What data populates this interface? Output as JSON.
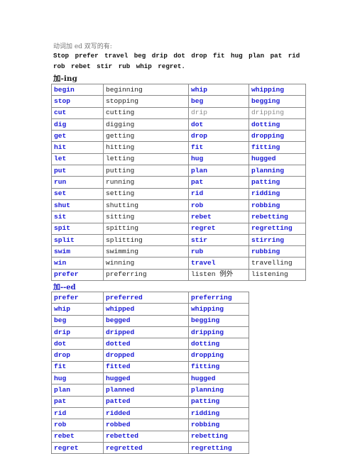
{
  "intro": "动词加 ed 双写的有:",
  "word_list": "Stop  prefer  travel   beg  drip  dot  drop  fit  hug plan  pat   rid   rob  rebet   stir   rub   whip   regret.",
  "ing_section": {
    "title": "加-ing",
    "rows": [
      [
        {
          "t": "begin",
          "c": "b"
        },
        {
          "t": "beginning",
          "c": "k"
        },
        {
          "t": "whip",
          "c": "b"
        },
        {
          "t": "whipping",
          "c": "b"
        }
      ],
      [
        {
          "t": "stop",
          "c": "b"
        },
        {
          "t": "stopping",
          "c": "k"
        },
        {
          "t": "beg",
          "c": "b"
        },
        {
          "t": "begging",
          "c": "b"
        }
      ],
      [
        {
          "t": "cut",
          "c": "b"
        },
        {
          "t": "cutting",
          "c": "k"
        },
        {
          "t": "drip",
          "c": "g"
        },
        {
          "t": "dripping",
          "c": "g"
        }
      ],
      [
        {
          "t": "dig",
          "c": "b"
        },
        {
          "t": "digging",
          "c": "k"
        },
        {
          "t": "dot",
          "c": "b"
        },
        {
          "t": "dotting",
          "c": "b"
        }
      ],
      [
        {
          "t": "get",
          "c": "b"
        },
        {
          "t": "getting",
          "c": "k"
        },
        {
          "t": "drop",
          "c": "b"
        },
        {
          "t": "dropping",
          "c": "b"
        }
      ],
      [
        {
          "t": "hit",
          "c": "b"
        },
        {
          "t": "hitting",
          "c": "k"
        },
        {
          "t": "fit",
          "c": "b"
        },
        {
          "t": "fitting",
          "c": "b"
        }
      ],
      [
        {
          "t": "let",
          "c": "b"
        },
        {
          "t": "letting",
          "c": "k"
        },
        {
          "t": "hug",
          "c": "b"
        },
        {
          "t": "hugged",
          "c": "b"
        }
      ],
      [
        {
          "t": "put",
          "c": "b"
        },
        {
          "t": "putting",
          "c": "k"
        },
        {
          "t": "plan",
          "c": "b"
        },
        {
          "t": "planning",
          "c": "b"
        }
      ],
      [
        {
          "t": "run",
          "c": "b"
        },
        {
          "t": "running",
          "c": "k"
        },
        {
          "t": "pat",
          "c": "b"
        },
        {
          "t": "patting",
          "c": "b"
        }
      ],
      [
        {
          "t": "set",
          "c": "b"
        },
        {
          "t": "setting",
          "c": "k"
        },
        {
          "t": "rid",
          "c": "b"
        },
        {
          "t": "ridding",
          "c": "b"
        }
      ],
      [
        {
          "t": "shut",
          "c": "b"
        },
        {
          "t": "shutting",
          "c": "k"
        },
        {
          "t": "rob",
          "c": "b"
        },
        {
          "t": "robbing",
          "c": "b"
        }
      ],
      [
        {
          "t": "sit",
          "c": "b"
        },
        {
          "t": "sitting",
          "c": "k"
        },
        {
          "t": "rebet",
          "c": "b"
        },
        {
          "t": "rebetting",
          "c": "b"
        }
      ],
      [
        {
          "t": "spit",
          "c": "b"
        },
        {
          "t": "spitting",
          "c": "k"
        },
        {
          "t": "regret",
          "c": "b"
        },
        {
          "t": "regretting",
          "c": "b"
        }
      ],
      [
        {
          "t": "split",
          "c": "b"
        },
        {
          "t": "splitting",
          "c": "k"
        },
        {
          "t": "stir",
          "c": "b"
        },
        {
          "t": "stirring",
          "c": "b"
        }
      ],
      [
        {
          "t": "swim",
          "c": "b"
        },
        {
          "t": "swimming",
          "c": "k"
        },
        {
          "t": "rub",
          "c": "b"
        },
        {
          "t": "rubbing",
          "c": "b"
        }
      ],
      [
        {
          "t": "win",
          "c": "b"
        },
        {
          "t": "winning",
          "c": "k"
        },
        {
          "t": "travel",
          "c": "b"
        },
        {
          "t": "travelling",
          "c": "k"
        }
      ],
      [
        {
          "t": "prefer",
          "c": "b"
        },
        {
          "t": "preferring",
          "c": "k"
        },
        {
          "t": "listen 例外",
          "c": "k"
        },
        {
          "t": "listening",
          "c": "k"
        }
      ]
    ]
  },
  "ed_section": {
    "title": "加--ed",
    "rows": [
      [
        {
          "t": "prefer",
          "c": "b"
        },
        {
          "t": "preferred",
          "c": "b"
        },
        {
          "t": "preferring",
          "c": "b"
        }
      ],
      [
        {
          "t": "whip",
          "c": "b"
        },
        {
          "t": "whipped",
          "c": "b"
        },
        {
          "t": "whipping",
          "c": "b"
        }
      ],
      [
        {
          "t": "beg",
          "c": "b"
        },
        {
          "t": "begged",
          "c": "b"
        },
        {
          "t": "begging",
          "c": "b"
        }
      ],
      [
        {
          "t": "drip",
          "c": "b"
        },
        {
          "t": "dripped",
          "c": "b"
        },
        {
          "t": "dripping",
          "c": "b"
        }
      ],
      [
        {
          "t": "dot",
          "c": "b"
        },
        {
          "t": "dotted",
          "c": "b"
        },
        {
          "t": "dotting",
          "c": "b"
        }
      ],
      [
        {
          "t": "drop",
          "c": "b"
        },
        {
          "t": "dropped",
          "c": "b"
        },
        {
          "t": "dropping",
          "c": "b"
        }
      ],
      [
        {
          "t": "fit",
          "c": "b"
        },
        {
          "t": "fitted",
          "c": "b"
        },
        {
          "t": "fitting",
          "c": "b"
        }
      ],
      [
        {
          "t": "hug",
          "c": "b"
        },
        {
          "t": "hugged",
          "c": "b"
        },
        {
          "t": "hugged",
          "c": "b"
        }
      ],
      [
        {
          "t": "plan",
          "c": "b"
        },
        {
          "t": "planned",
          "c": "b"
        },
        {
          "t": "planning",
          "c": "b"
        }
      ],
      [
        {
          "t": "pat",
          "c": "b"
        },
        {
          "t": "patted",
          "c": "b"
        },
        {
          "t": "patting",
          "c": "b"
        }
      ],
      [
        {
          "t": "rid",
          "c": "b"
        },
        {
          "t": "ridded",
          "c": "b"
        },
        {
          "t": "ridding",
          "c": "b"
        }
      ],
      [
        {
          "t": "rob",
          "c": "b"
        },
        {
          "t": "robbed",
          "c": "b"
        },
        {
          "t": "robbing",
          "c": "b"
        }
      ],
      [
        {
          "t": "rebet",
          "c": "b"
        },
        {
          "t": "rebetted",
          "c": "b"
        },
        {
          "t": "rebetting",
          "c": "b"
        }
      ],
      [
        {
          "t": "regret",
          "c": "b"
        },
        {
          "t": "regretted",
          "c": "b"
        },
        {
          "t": "regretting",
          "c": "b"
        }
      ]
    ]
  },
  "colors": {
    "blue_text": "#1a1ad6",
    "black_text": "#222222",
    "gray_text": "#8a8a8a",
    "border": "#8a8a8a"
  }
}
